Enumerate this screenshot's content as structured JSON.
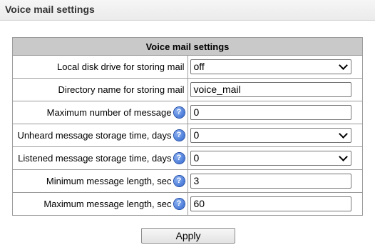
{
  "page": {
    "title": "Voice mail settings"
  },
  "table": {
    "header": "Voice mail settings",
    "rows": [
      {
        "label": "Local disk drive for storing mail",
        "type": "select",
        "value": "off",
        "help": false
      },
      {
        "label": "Directory name for storing mail",
        "type": "input",
        "value": "voice_mail",
        "help": false
      },
      {
        "label": "Maximum number of message",
        "type": "input",
        "value": "0",
        "help": true
      },
      {
        "label": "Unheard message storage time, days",
        "type": "select",
        "value": "0",
        "help": true
      },
      {
        "label": "Listened message storage time, days",
        "type": "select",
        "value": "0",
        "help": true
      },
      {
        "label": "Minimum message length, sec",
        "type": "input",
        "value": "3",
        "help": true
      },
      {
        "label": "Maximum message length, sec",
        "type": "input",
        "value": "60",
        "help": true
      }
    ]
  },
  "actions": {
    "apply_label": "Apply"
  },
  "icons": {
    "help": "help-icon",
    "help_glyph": "?",
    "dropdown": "chevron-down-icon"
  },
  "colors": {
    "header_bg": "#c9c9c9",
    "help_icon": "#2c62cc",
    "border": "#9c9c9c"
  }
}
